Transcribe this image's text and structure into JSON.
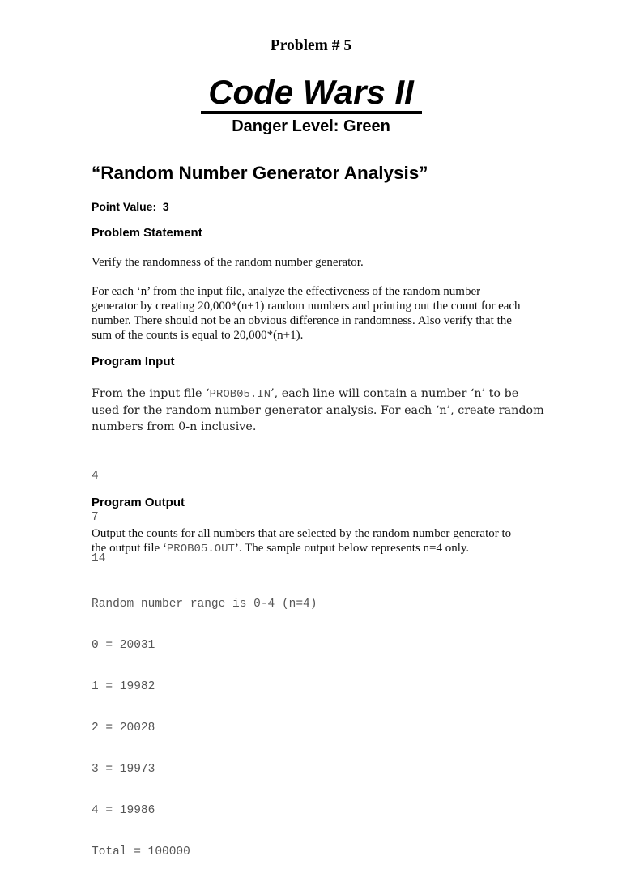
{
  "header": {
    "problem_number": "Problem # 5",
    "title": "Code Wars II",
    "danger_level": "Danger Level: Green"
  },
  "problem": {
    "name": "“Random Number Generator Analysis”",
    "point_value_label": "Point Value:  3"
  },
  "statement": {
    "heading": "Problem Statement",
    "intro": "Verify the randomness of the random number generator.",
    "paragraph_lines": [
      "For each ‘n’ from the input file, analyze the effectiveness of the random number",
      "generator by creating 20,000*(n+1) random numbers and printing out the count for each",
      "number. There should not be an obvious difference in randomness. Also verify that the",
      "sum of the counts is equal to 20,000*(n+1)."
    ]
  },
  "input": {
    "heading": "Program Input",
    "line1_before": "From the input file ‘",
    "filename": "PROB05.IN",
    "line1_after": "’, each line will contain a number ‘n’ to be",
    "line2": "used for the random number generator analysis. For each ‘n’, create random",
    "line3": "numbers from 0-n inclusive.",
    "values": [
      "4",
      "7",
      "14"
    ]
  },
  "output": {
    "heading": "Program Output",
    "line1": "Output the counts for all numbers that are selected by the random number generator to",
    "line2_before": "the output file ‘",
    "filename": "PROB05.OUT",
    "line2_after": "’. The sample output below represents n=4 only.",
    "sample_lines": [
      "Random number range is 0-4 (n=4)",
      "0 = 20031",
      "1 = 19982",
      "2 = 20028",
      "3 = 19973",
      "4 = 19986",
      "Total = 100000"
    ]
  }
}
